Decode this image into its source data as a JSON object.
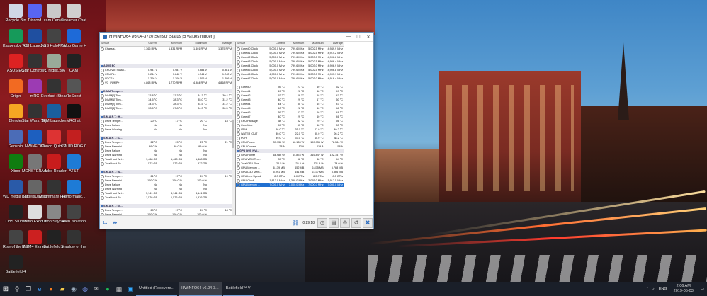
{
  "window": {
    "title": "HWiNFO64 v6.04-3720 Sensor Status [5 values hidden]",
    "controls": {
      "minimize": "—",
      "maximize": "☐",
      "close": "✕"
    }
  },
  "left_pane": {
    "headers": [
      "Sensor",
      "Current",
      "Minimum",
      "Maximum",
      "Average"
    ],
    "rows": [
      {
        "type": "item",
        "name": "Chassis1",
        "v": [
          "1,366 RPM",
          "1,331 RPM",
          "1,401 RPM",
          "1,375 RPM"
        ]
      },
      {
        "type": "blank"
      },
      {
        "type": "blank"
      },
      {
        "type": "blank"
      },
      {
        "type": "group",
        "name": "ASUS EC"
      },
      {
        "type": "item",
        "name": "CPU Vcc Sustai...",
        "v": [
          "0.981 V",
          "0.981 V",
          "0.984 V",
          "0.981 V"
        ]
      },
      {
        "type": "item",
        "name": "CPU PLL",
        "v": [
          "1.244 V",
          "1.242 V",
          "1.244 V",
          "1.242 V"
        ]
      },
      {
        "type": "item",
        "name": "VCCSA",
        "v": [
          "1.206 V",
          "1.206 V",
          "1.206 V",
          "1.206 V"
        ]
      },
      {
        "type": "item",
        "name": "VC_PUMP+",
        "v": [
          "4,868 RPM",
          "4,770 RPM",
          "4,984 RPM",
          "4,868 RPM"
        ]
      },
      {
        "type": "blank"
      },
      {
        "type": "group",
        "name": "DIMM Temper..."
      },
      {
        "type": "item",
        "name": "DIMM[0] Tem...",
        "v": [
          "33.8 °C",
          "27.3 °C",
          "34.3 °C",
          "30.4 °C"
        ]
      },
      {
        "type": "item",
        "name": "DIMM[1] Tem...",
        "v": [
          "34.5 °C",
          "28.3 °C",
          "35.0 °C",
          "31.2 °C"
        ]
      },
      {
        "type": "item",
        "name": "DIMM[2] Tem...",
        "v": [
          "34.3 °C",
          "28.3 °C",
          "34.5 °C",
          "31.2 °C"
        ]
      },
      {
        "type": "item",
        "name": "DIMM[3] Tem...",
        "v": [
          "33.5 °C",
          "27.8 °C",
          "34.3 °C",
          "30.5 °C"
        ]
      },
      {
        "type": "blank"
      },
      {
        "type": "group",
        "name": "S.M.A.R.T.: H..."
      },
      {
        "type": "item",
        "name": "Drive Temper...",
        "v": [
          "20 °C",
          "17 °C",
          "20 °C",
          "18 °C"
        ]
      },
      {
        "type": "item",
        "name": "Drive Failure",
        "v": [
          "No",
          "No",
          "No",
          ""
        ]
      },
      {
        "type": "item",
        "name": "Drive Warning",
        "v": [
          "No",
          "No",
          "No",
          ""
        ]
      },
      {
        "type": "blank"
      },
      {
        "type": "group",
        "name": "S.M.A.R.T.: C..."
      },
      {
        "type": "item",
        "name": "Drive Temper...",
        "v": [
          "22 °C",
          "20 °C",
          "25 °C",
          "21 °C"
        ]
      },
      {
        "type": "item",
        "name": "Drive Remaini...",
        "v": [
          "99.0 %",
          "99.0 %",
          "99.0 %",
          ""
        ]
      },
      {
        "type": "item",
        "name": "Drive Failure",
        "v": [
          "No",
          "No",
          "No",
          ""
        ]
      },
      {
        "type": "item",
        "name": "Drive Warning",
        "v": [
          "No",
          "No",
          "No",
          ""
        ]
      },
      {
        "type": "item",
        "name": "Total Host Wri...",
        "v": [
          "1,468 GB",
          "1,468 GB",
          "1,468 GB",
          ""
        ]
      },
      {
        "type": "item",
        "name": "Total Host Re...",
        "v": [
          "572 GB",
          "572 GB",
          "572 GB",
          ""
        ]
      },
      {
        "type": "blank"
      },
      {
        "type": "group",
        "name": "S.M.A.R.T.: S..."
      },
      {
        "type": "item",
        "name": "Drive Temper...",
        "v": [
          "21 °C",
          "17 °C",
          "24 °C",
          "19 °C"
        ]
      },
      {
        "type": "item",
        "name": "Drive Remaini...",
        "v": [
          "100.0 %",
          "100.0 %",
          "100.0 %",
          ""
        ]
      },
      {
        "type": "item",
        "name": "Drive Failure",
        "v": [
          "No",
          "No",
          "No",
          ""
        ]
      },
      {
        "type": "item",
        "name": "Drive Warning",
        "v": [
          "No",
          "No",
          "No",
          ""
        ]
      },
      {
        "type": "item",
        "name": "Total Host Wri...",
        "v": [
          "3,141 GB",
          "3,141 GB",
          "3,141 GB",
          ""
        ]
      },
      {
        "type": "item",
        "name": "Total Host Re...",
        "v": [
          "1,576 GB",
          "1,576 GB",
          "1,576 GB",
          ""
        ]
      },
      {
        "type": "blank"
      },
      {
        "type": "group",
        "name": "S.M.A.R.T.: G..."
      },
      {
        "type": "item",
        "name": "Drive Temper...",
        "v": [
          "20 °C",
          "17 °C",
          "24 °C",
          "18 °C"
        ]
      },
      {
        "type": "item",
        "name": "Drive Remaini...",
        "v": [
          "100.0 %",
          "100.0 %",
          "100.0 %",
          ""
        ]
      }
    ]
  },
  "right_pane": {
    "headers": [
      "Sensor",
      "Current",
      "Minimum",
      "Maximum",
      "Average"
    ],
    "rows": [
      {
        "type": "item",
        "name": "Core #0 Clock",
        "v": [
          "5,000.0 MHz",
          "799.6 MHz",
          "5,002.5 MHz",
          "4,949.9 MHz"
        ]
      },
      {
        "type": "item",
        "name": "Core #1 Clock",
        "v": [
          "5,000.0 MHz",
          "799.6 MHz",
          "5,002.5 MHz",
          "4,914.2 MHz"
        ]
      },
      {
        "type": "item",
        "name": "Core #2 Clock",
        "v": [
          "5,000.0 MHz",
          "799.6 MHz",
          "5,003.0 MHz",
          "4,906.6 MHz"
        ]
      },
      {
        "type": "item",
        "name": "Core #3 Clock",
        "v": [
          "5,000.0 MHz",
          "799.6 MHz",
          "5,002.5 MHz",
          "4,906.4 MHz"
        ]
      },
      {
        "type": "item",
        "name": "Core #4 Clock",
        "v": [
          "5,000.0 MHz",
          "799.6 MHz",
          "5,003.0 MHz",
          "4,906.9 MHz"
        ]
      },
      {
        "type": "item",
        "name": "Core #5 Clock",
        "v": [
          "5,000.0 MHz",
          "799.6 MHz",
          "5,002.5 MHz",
          "4,906.8 MHz"
        ]
      },
      {
        "type": "item",
        "name": "Core #6 Clock",
        "v": [
          "4,900.0 MHz",
          "799.6 MHz",
          "5,003.0 MHz",
          "4,907.1 MHz"
        ]
      },
      {
        "type": "item",
        "name": "Core #7 Clock",
        "v": [
          "5,000.0 MHz",
          "799.6 MHz",
          "5,003.0 MHz",
          "4,916.4 MHz"
        ]
      },
      {
        "type": "blank"
      },
      {
        "type": "item",
        "name": "Core #0",
        "v": [
          "39 °C",
          "27 °C",
          "60 °C",
          "52 °C"
        ]
      },
      {
        "type": "item",
        "name": "Core #1",
        "v": [
          "49 °C",
          "26 °C",
          "68 °C",
          "49 °C"
        ]
      },
      {
        "type": "item",
        "name": "Core #2",
        "v": [
          "52 °C",
          "29 °C",
          "68 °C",
          "47 °C"
        ]
      },
      {
        "type": "item",
        "name": "Core #3",
        "v": [
          "40 °C",
          "29 °C",
          "67 °C",
          "50 °C"
        ]
      },
      {
        "type": "item",
        "name": "Core #4",
        "v": [
          "44 °C",
          "30 °C",
          "65 °C",
          "47 °C"
        ]
      },
      {
        "type": "item",
        "name": "Core #5",
        "v": [
          "40 °C",
          "28 °C",
          "66 °C",
          "48 °C"
        ]
      },
      {
        "type": "item",
        "name": "Core #6",
        "v": [
          "39 °C",
          "27 °C",
          "66 °C",
          "48 °C"
        ]
      },
      {
        "type": "item",
        "name": "Core #7",
        "v": [
          "40 °C",
          "29 °C",
          "60 °C",
          "46 °C"
        ]
      },
      {
        "type": "item",
        "name": "CPU Package",
        "v": [
          "58 °C",
          "32 °C",
          "70 °C",
          "56 °C"
        ]
      },
      {
        "type": "item",
        "name": "Core Max",
        "v": [
          "59 °C",
          "31 °C",
          "68 °C",
          "53 °C"
        ]
      },
      {
        "type": "item",
        "name": "VRM",
        "v": [
          "46.0 °C",
          "35.0 °C",
          "47.0 °C",
          "40.2 °C"
        ]
      },
      {
        "type": "item",
        "name": "WATER_OUT",
        "v": [
          "30.0 °C",
          "22.0 °C",
          "30.0 °C",
          "26.2 °C"
        ]
      },
      {
        "type": "item",
        "name": "PCH",
        "v": [
          "39.0 °C",
          "37.0 °C",
          "40.0 °C",
          "38.2 °C"
        ]
      },
      {
        "type": "item",
        "name": "CPU Power",
        "v": [
          "37.932 W",
          "16.128 W",
          "159.936 W",
          "78.384 W"
        ]
      },
      {
        "type": "item",
        "name": "CPU Current",
        "v": [
          "28 A",
          "12 A",
          "119 A",
          "58 A"
        ]
      },
      {
        "type": "group",
        "name": "GPU [#0]: NVI..."
      },
      {
        "type": "item",
        "name": "GPU Power",
        "v": [
          "68.986 W",
          "64.878 W",
          "316.847 W",
          "192.157 W"
        ]
      },
      {
        "type": "item",
        "name": "GPU VRM Tem...",
        "v": [
          "39 °C",
          "38 °C",
          "48 °C",
          "44 °C"
        ]
      },
      {
        "type": "item",
        "name": "Total GPU Pow...",
        "v": [
          "26.5 %",
          "25.5 %",
          "121.9 %",
          "74.0 %"
        ]
      },
      {
        "type": "item",
        "name": "GPU Memory ...",
        "v": [
          "6,139 MB",
          "652 MB",
          "6,875 MB",
          "5,768 MB"
        ]
      },
      {
        "type": "item",
        "name": "GPU D3D Mem...",
        "v": [
          "5,991 MB",
          "441 MB",
          "6,477 MB",
          "5,366 MB"
        ]
      },
      {
        "type": "item",
        "name": "GPU Link Speed",
        "v": [
          "8.0 GT/s",
          "8.0 GT/s",
          "8.0 GT/s",
          "8.0 GT/s"
        ]
      },
      {
        "type": "item",
        "name": "GPU Clock",
        "v": [
          "1,817.0 MHz",
          "1,350.0 MHz",
          "2,055.0 MHz",
          "1,917.5 MHz"
        ]
      },
      {
        "type": "sel",
        "name": "GPU Memory ...",
        "v": [
          "7,000.0 MHz",
          "7,000.0 MHz",
          "7,000.0 MHz",
          "7,000.0 MHz"
        ]
      }
    ]
  },
  "statusbar": {
    "timer": "0:29:18"
  },
  "desktop_icons": [
    {
      "label": "Recycle Bin",
      "color": "#cfd8e6"
    },
    {
      "label": "Discord",
      "color": "#5865f2"
    },
    {
      "label": "cam Center",
      "color": "#c9c9c9"
    },
    {
      "label": "Streamer Chat",
      "color": "#d0d0d0"
    },
    {
      "label": "Kaspersky Total Security",
      "color": "#169a5a"
    },
    {
      "label": "RSI Launcher",
      "color": "#1f4fa0"
    },
    {
      "label": "XSS HoloFRAME",
      "color": "#444"
    },
    {
      "label": "Turbo Game Hub",
      "color": "#1e6ad8"
    },
    {
      "label": "ASUS EC",
      "color": "#d22"
    },
    {
      "label": "Star Control: Origins",
      "color": "#333"
    },
    {
      "label": "vc_redist.x86",
      "color": "#9a9"
    },
    {
      "label": "CAM",
      "color": "#222"
    },
    {
      "label": "Origin",
      "color": "#f26a22"
    },
    {
      "label": "mRC",
      "color": "#9c3bb3"
    },
    {
      "label": "Everlast (Steam)",
      "color": "#333"
    },
    {
      "label": "ReSpect",
      "color": "#555"
    },
    {
      "label": "Blender",
      "color": "#f5a623"
    },
    {
      "label": "Star Wars: Squadrons",
      "color": "#333"
    },
    {
      "label": "TPM Launcher",
      "color": "#1a5f9e"
    },
    {
      "label": "VRChat",
      "color": "#111"
    },
    {
      "label": "Genshin",
      "color": "#4b6cb7"
    },
    {
      "label": "HWiNFO64",
      "color": "#1d5fbf"
    },
    {
      "label": "Canon Quick Menu",
      "color": "#d33"
    },
    {
      "label": "CPUID ROG CPU-Z",
      "color": "#c21f1f"
    },
    {
      "label": "Xbox",
      "color": "#107c10"
    },
    {
      "label": "MONSTER HUNTER",
      "color": "#777"
    },
    {
      "label": "Adobe Reader",
      "color": "#c81c1c"
    },
    {
      "label": "AT&T",
      "color": "#1e7bd6"
    },
    {
      "label": "WD media Shortcut",
      "color": "#2a5aa8"
    },
    {
      "label": "BattleIsDaw Shortcut",
      "color": "#666"
    },
    {
      "label": "Nightmare Flight Gurn...",
      "color": "#333"
    },
    {
      "label": "Performanc...",
      "color": "#1e7bd6"
    },
    {
      "label": "OBS Studio",
      "color": "#222"
    },
    {
      "label": "Metro Exodus",
      "color": "#ddd"
    },
    {
      "label": "Orion Saynes",
      "color": "#888"
    },
    {
      "label": "Alien Isolation",
      "color": "#444"
    },
    {
      "label": "Rise of the Tomb Raider",
      "color": "#444"
    },
    {
      "label": "MGM4 Extreme",
      "color": "#cc2020"
    },
    {
      "label": "Battlefield V",
      "color": "#222"
    },
    {
      "label": "Shadow of the Tomb...",
      "color": "#333"
    },
    {
      "label": "Battlefield 4",
      "color": "#222"
    }
  ],
  "taskbar": {
    "start_icon": "windows-logo-icon",
    "apps": [
      {
        "label": "Untitled (Recovere...",
        "active": false
      },
      {
        "label": "HWiNFO64 v6.04-3...",
        "active": true
      },
      {
        "label": "Battlefield™ V",
        "active": false
      }
    ],
    "tray": {
      "lang": "ENG",
      "time": "2:06 AM",
      "date": "2019-05-03"
    }
  },
  "colors": {
    "accent": "#1f6fd0",
    "taskbar": "#1a1f29",
    "group_header": "#e7e7ee"
  }
}
